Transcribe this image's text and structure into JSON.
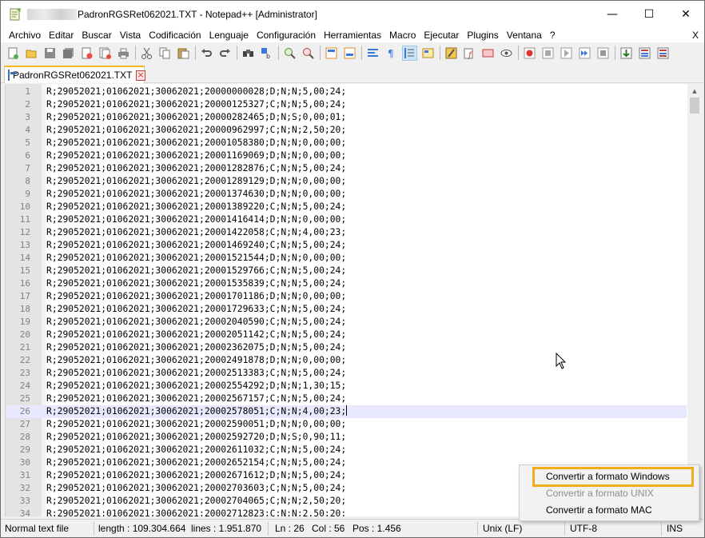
{
  "window": {
    "title_blurred_prefix": "",
    "title": "PadronRGSRet062021.TXT - Notepad++ [Administrator]",
    "controls": {
      "minimize": "—",
      "maximize": "☐",
      "close": "✕"
    }
  },
  "menu": {
    "items": [
      "Archivo",
      "Editar",
      "Buscar",
      "Vista",
      "Codificación",
      "Lenguaje",
      "Configuración",
      "Herramientas",
      "Macro",
      "Ejecutar",
      "Plugins",
      "Ventana",
      "?"
    ],
    "close": "X"
  },
  "toolbar": {
    "icons": [
      "new-file-icon",
      "open-file-icon",
      "save-icon",
      "save-all-icon",
      "close-icon",
      "close-all-icon",
      "print-icon",
      "cut-icon",
      "copy-icon",
      "paste-icon",
      "undo-icon",
      "redo-icon",
      "find-icon",
      "replace-icon",
      "zoom-in-icon",
      "zoom-out-icon",
      "sync-vertical-icon",
      "sync-horizontal-icon",
      "word-wrap-icon",
      "show-all-characters-icon",
      "indent-guide-icon",
      "doc-map-icon",
      "function-list-icon",
      "folder-workspace-icon",
      "monitoring-icon",
      "record-macro-icon",
      "stop-record-icon",
      "play-macro-icon",
      "play-multiple-icon",
      "save-macro-icon",
      "bookmark-icon",
      "panel-icon",
      "panel-alt-icon"
    ]
  },
  "tab": {
    "label": "PadronRGSRet062021.TXT"
  },
  "editor": {
    "current_line": 26,
    "lines": [
      {
        "n": "1",
        "text": "R;29052021;01062021;30062021;20000000028;D;N;N;5,00;24;"
      },
      {
        "n": "2",
        "text": "R;29052021;01062021;30062021;20000125327;C;N;N;5,00;24;"
      },
      {
        "n": "3",
        "text": "R;29052021;01062021;30062021;20000282465;D;N;S;0,00;01;"
      },
      {
        "n": "4",
        "text": "R;29052021;01062021;30062021;20000962997;C;N;N;2,50;20;"
      },
      {
        "n": "5",
        "text": "R;29052021;01062021;30062021;20001058380;D;N;N;0,00;00;"
      },
      {
        "n": "6",
        "text": "R;29052021;01062021;30062021;20001169069;D;N;N;0,00;00;"
      },
      {
        "n": "7",
        "text": "R;29052021;01062021;30062021;20001282876;C;N;N;5,00;24;"
      },
      {
        "n": "8",
        "text": "R;29052021;01062021;30062021;20001289129;D;N;N;0,00;00;"
      },
      {
        "n": "9",
        "text": "R;29052021;01062021;30062021;20001374630;D;N;N;0,00;00;"
      },
      {
        "n": "10",
        "text": "R;29052021;01062021;30062021;20001389220;C;N;N;5,00;24;"
      },
      {
        "n": "11",
        "text": "R;29052021;01062021;30062021;20001416414;D;N;N;0,00;00;"
      },
      {
        "n": "12",
        "text": "R;29052021;01062021;30062021;20001422058;C;N;N;4,00;23;"
      },
      {
        "n": "13",
        "text": "R;29052021;01062021;30062021;20001469240;C;N;N;5,00;24;"
      },
      {
        "n": "14",
        "text": "R;29052021;01062021;30062021;20001521544;D;N;N;0,00;00;"
      },
      {
        "n": "15",
        "text": "R;29052021;01062021;30062021;20001529766;C;N;N;5,00;24;"
      },
      {
        "n": "16",
        "text": "R;29052021;01062021;30062021;20001535839;C;N;N;5,00;24;"
      },
      {
        "n": "17",
        "text": "R;29052021;01062021;30062021;20001701186;D;N;N;0,00;00;"
      },
      {
        "n": "18",
        "text": "R;29052021;01062021;30062021;20001729633;C;N;N;5,00;24;"
      },
      {
        "n": "19",
        "text": "R;29052021;01062021;30062021;20002040590;C;N;N;5,00;24;"
      },
      {
        "n": "20",
        "text": "R;29052021;01062021;30062021;20002051142;C;N;N;5,00;24;"
      },
      {
        "n": "21",
        "text": "R;29052021;01062021;30062021;20002362075;D;N;N;5,00;24;"
      },
      {
        "n": "22",
        "text": "R;29052021;01062021;30062021;20002491878;D;N;N;0,00;00;"
      },
      {
        "n": "23",
        "text": "R;29052021;01062021;30062021;20002513383;C;N;N;5,00;24;"
      },
      {
        "n": "24",
        "text": "R;29052021;01062021;30062021;20002554292;D;N;N;1,30;15;"
      },
      {
        "n": "25",
        "text": "R;29052021;01062021;30062021;20002567157;C;N;N;5,00;24;"
      },
      {
        "n": "26",
        "text": "R;29052021;01062021;30062021;20002578051;C;N;N;4,00;23;"
      },
      {
        "n": "27",
        "text": "R;29052021;01062021;30062021;20002590051;D;N;N;0,00;00;"
      },
      {
        "n": "28",
        "text": "R;29052021;01062021;30062021;20002592720;D;N;S;0,90;11;"
      },
      {
        "n": "29",
        "text": "R;29052021;01062021;30062021;20002611032;C;N;N;5,00;24;"
      },
      {
        "n": "30",
        "text": "R;29052021;01062021;30062021;20002652154;C;N;N;5,00;24;"
      },
      {
        "n": "31",
        "text": "R;29052021;01062021;30062021;20002671612;D;N;N;5,00;24;"
      },
      {
        "n": "32",
        "text": "R;29052021;01062021;30062021;20002703603;C;N;N;5,00;24;"
      },
      {
        "n": "33",
        "text": "R;29052021;01062021;30062021;20002704065;C;N;N;2,50;20;"
      },
      {
        "n": "34",
        "text": "R;29052021;01062021;30062021;20002712823;C;N;N;2,50;20;"
      }
    ]
  },
  "context_menu": {
    "items": [
      {
        "label": "Convertir a formato Windows",
        "disabled": false,
        "highlighted": true
      },
      {
        "label": "Convertir a formato UNIX",
        "disabled": true,
        "highlighted": false
      },
      {
        "label": "Convertir a formato MAC",
        "disabled": false,
        "highlighted": false
      }
    ],
    "highlight_color": "#f0ac1d"
  },
  "status": {
    "file_type": "Normal text file",
    "length": "length : 109.304.664",
    "lines": "lines : 1.951.870",
    "ln": "Ln : 26",
    "col": "Col : 56",
    "pos": "Pos : 1.456",
    "eol": "Unix (LF)",
    "encoding": "UTF-8",
    "mode": "INS"
  }
}
